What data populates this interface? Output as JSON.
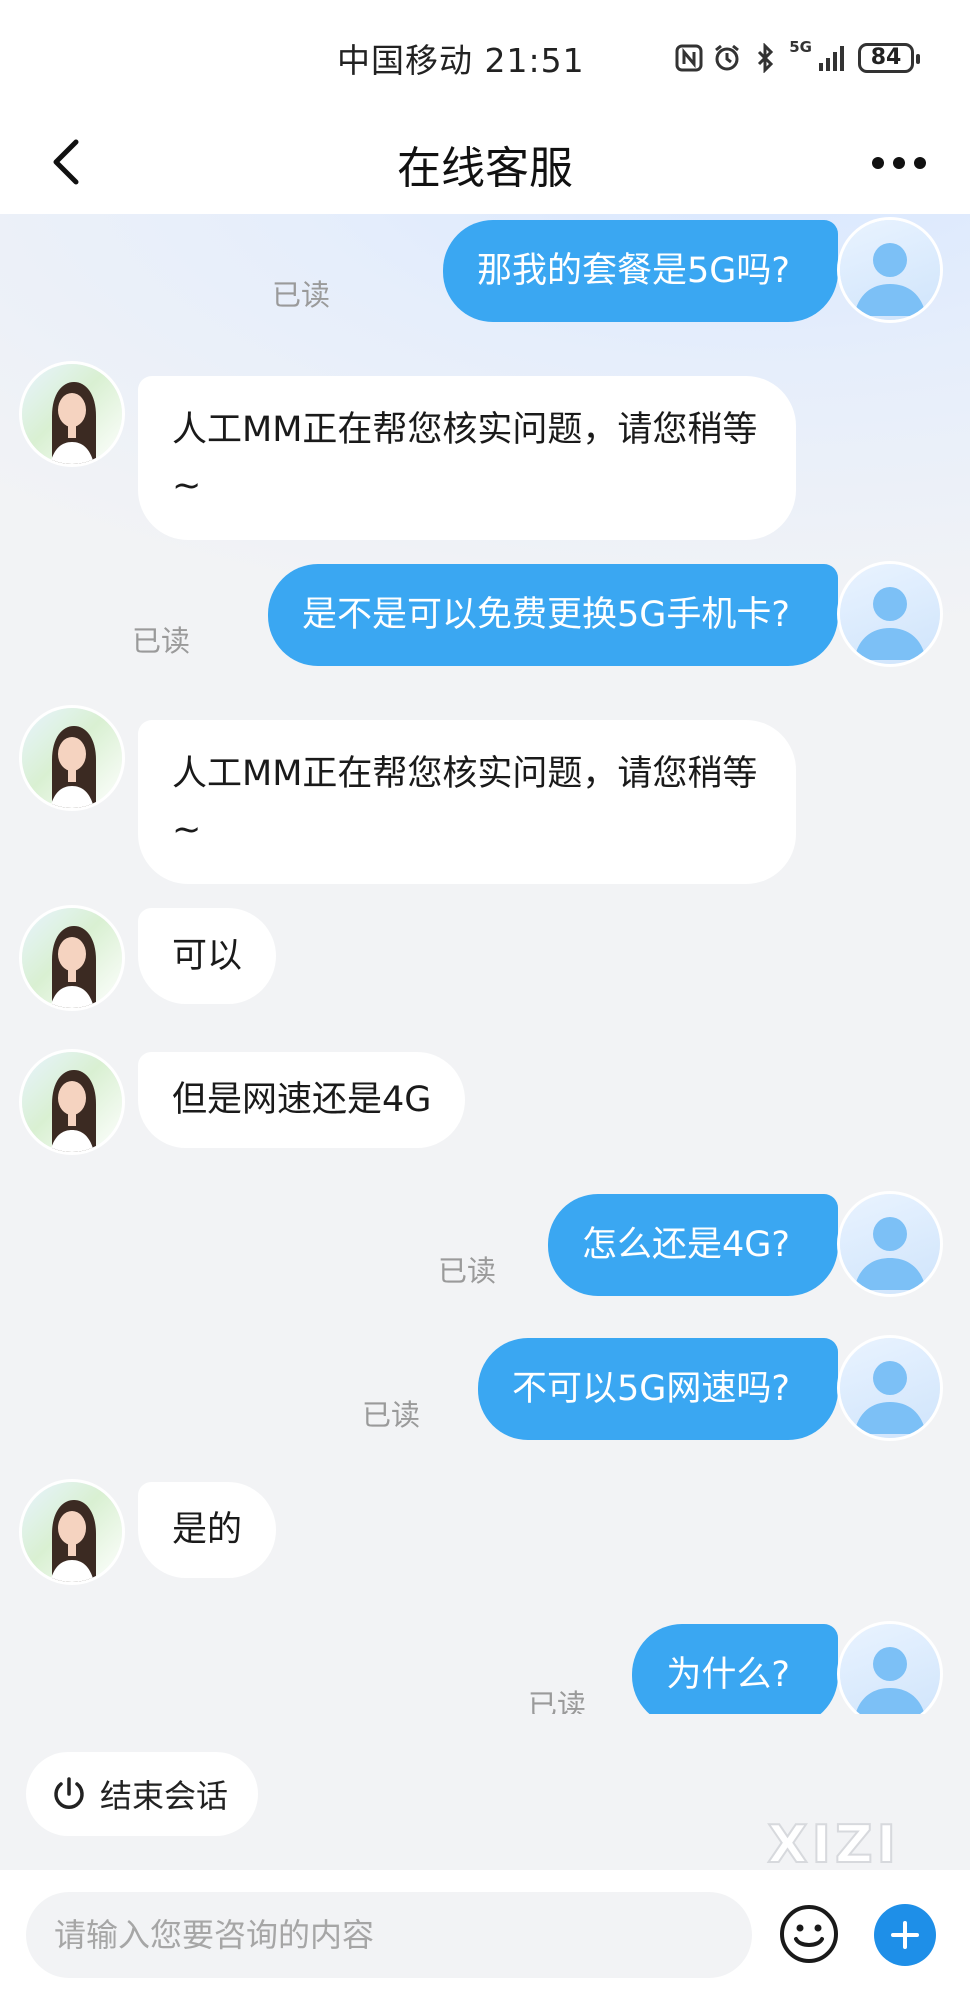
{
  "status_bar": {
    "carrier_time": "中国移动 21:51",
    "network": "5G",
    "battery": "84"
  },
  "nav": {
    "title": "在线客服"
  },
  "messages": [
    {
      "from": "user",
      "text": "那我的套餐是5G吗?",
      "read": "已读"
    },
    {
      "from": "agent",
      "text": "人工MM正在帮您核实问题，请您稍等~"
    },
    {
      "from": "user",
      "text": "是不是可以免费更换5G手机卡?",
      "read": "已读"
    },
    {
      "from": "agent",
      "text": "人工MM正在帮您核实问题，请您稍等~"
    },
    {
      "from": "agent",
      "text": "可以"
    },
    {
      "from": "agent",
      "text": "但是网速还是4G"
    },
    {
      "from": "user",
      "text": "怎么还是4G?",
      "read": "已读"
    },
    {
      "from": "user",
      "text": "不可以5G网速吗?",
      "read": "已读"
    },
    {
      "from": "agent",
      "text": "是的"
    },
    {
      "from": "user",
      "text": "为什么?",
      "read": "已读"
    }
  ],
  "end_session": {
    "label": "结束会话"
  },
  "watermark": "XIZI",
  "input": {
    "placeholder": "请输入您要咨询的内容"
  },
  "icons": {
    "back": "chevron-left-icon",
    "more": "more-icon",
    "power": "power-icon",
    "emoji": "emoji-icon",
    "plus": "plus-icon",
    "nfc": "nfc-icon",
    "alarm": "alarm-icon",
    "bluetooth": "bluetooth-icon",
    "signal": "signal-icon"
  },
  "colors": {
    "bubble_out": "#3aa7f2",
    "accent": "#1e8fe8",
    "background": "#f2f3f5"
  }
}
